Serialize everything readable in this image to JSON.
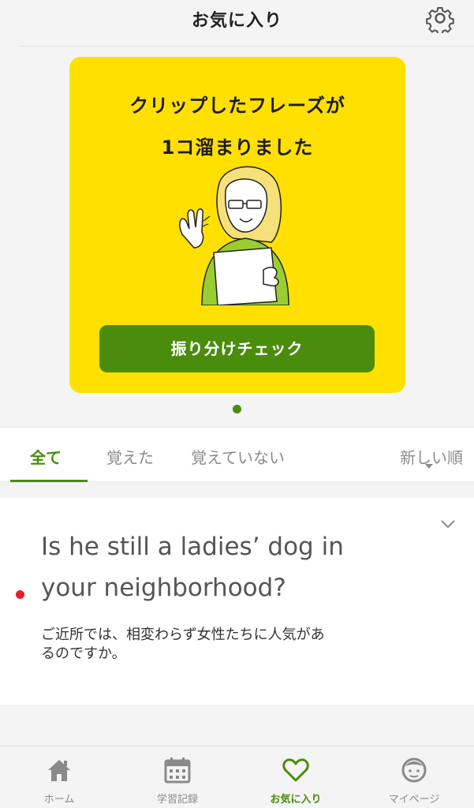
{
  "header": {
    "title": "お気に入り",
    "settings_icon": "gear-icon"
  },
  "banner": {
    "line1": "クリップしたフレーズが",
    "line2": "1コ溜まりました",
    "button_label": "振り分けチェック",
    "background": "#ffe000",
    "button_color": "#4a8c0c"
  },
  "filters": {
    "tabs": [
      {
        "label": "全て",
        "active": true
      },
      {
        "label": "覚えた",
        "active": false
      },
      {
        "label": "覚えていない",
        "active": false
      }
    ],
    "sort_label": "新しい順"
  },
  "phrase": {
    "english_line1": "Is he still a ladies’ dog in",
    "english_line2": "your neighborhood?",
    "japanese_line1": "ご近所では、相変わらず女性たちに人気があ",
    "japanese_line2": "るのですか。"
  },
  "nav": {
    "items": [
      {
        "label": "ホーム",
        "icon": "home-icon",
        "active": false
      },
      {
        "label": "学習記録",
        "icon": "calendar-icon",
        "active": false
      },
      {
        "label": "お気に入り",
        "icon": "heart-icon",
        "active": true
      },
      {
        "label": "マイページ",
        "icon": "face-icon",
        "active": false
      }
    ]
  },
  "colors": {
    "accent": "#4a8c0c",
    "unread": "#e8202a"
  }
}
